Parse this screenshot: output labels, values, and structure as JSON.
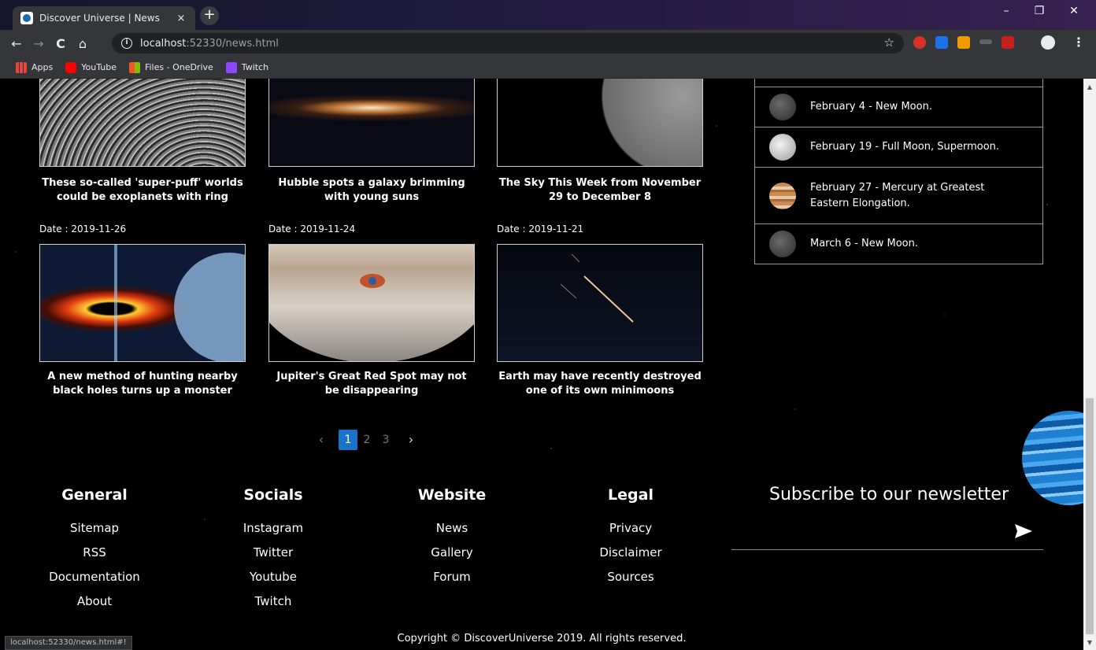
{
  "browser": {
    "tab_title": "Discover Universe | News",
    "tab_close": "×",
    "new_tab": "+",
    "url_host": "localhost",
    "url_rest": ":52330/news.html",
    "minimize": "–",
    "restore": "❐",
    "close": "✕",
    "back": "←",
    "forward": "→",
    "reload": "C",
    "home": "⌂",
    "star": "☆",
    "menu": "⋮",
    "bookmarks": [
      {
        "label": "Apps",
        "icon": "apps-icon",
        "color": "#e8453c"
      },
      {
        "label": "YouTube",
        "icon": "youtube-icon",
        "color": "#ff0000"
      },
      {
        "label": "Files - OneDrive",
        "icon": "onedrive-icon",
        "color": "#f35325"
      },
      {
        "label": "Twitch",
        "icon": "twitch-icon",
        "color": "#9146ff"
      }
    ],
    "status_url": "localhost:52330/news.html#!"
  },
  "articles": [
    {
      "title": "These so-called 'super-puff' worlds could be exoplanets with ring",
      "date": ""
    },
    {
      "title": "Hubble spots a galaxy brimming with young suns",
      "date": ""
    },
    {
      "title": "The Sky This Week from November 29 to December 8",
      "date": ""
    },
    {
      "title": "A new method of hunting nearby black holes turns up a monster",
      "date": "Date : 2019-11-26"
    },
    {
      "title": "Jupiter's Great Red Spot may not be disappearing",
      "date": "Date : 2019-11-24"
    },
    {
      "title": "Earth may have recently destroyed one of its own minimoons",
      "date": "Date : 2019-11-21"
    }
  ],
  "events": [
    {
      "text": "February 4 - New Moon."
    },
    {
      "text": "February 19 - Full Moon, Supermoon."
    },
    {
      "text": "February 27 - Mercury at Greatest Eastern Elongation."
    },
    {
      "text": "March 6 - New Moon."
    }
  ],
  "pagination": {
    "prev": "‹",
    "pages": [
      "1",
      "2",
      "3"
    ],
    "current": "1",
    "next": "›"
  },
  "footer": {
    "columns": [
      {
        "heading": "General",
        "links": [
          "Sitemap",
          "RSS",
          "Documentation",
          "About"
        ]
      },
      {
        "heading": "Socials",
        "links": [
          "Instagram",
          "Twitter",
          "Youtube",
          "Twitch"
        ]
      },
      {
        "heading": "Website",
        "links": [
          "News",
          "Gallery",
          "Forum"
        ]
      },
      {
        "heading": "Legal",
        "links": [
          "Privacy",
          "Disclaimer",
          "Sources"
        ]
      }
    ],
    "newsletter_title": "Subscribe to our newsletter",
    "copyright": "Copyright © DiscoverUniverse 2019. All rights reserved."
  },
  "colors": {
    "accent": "#1a73c8",
    "background": "#000000",
    "chrome": "#35363a"
  }
}
